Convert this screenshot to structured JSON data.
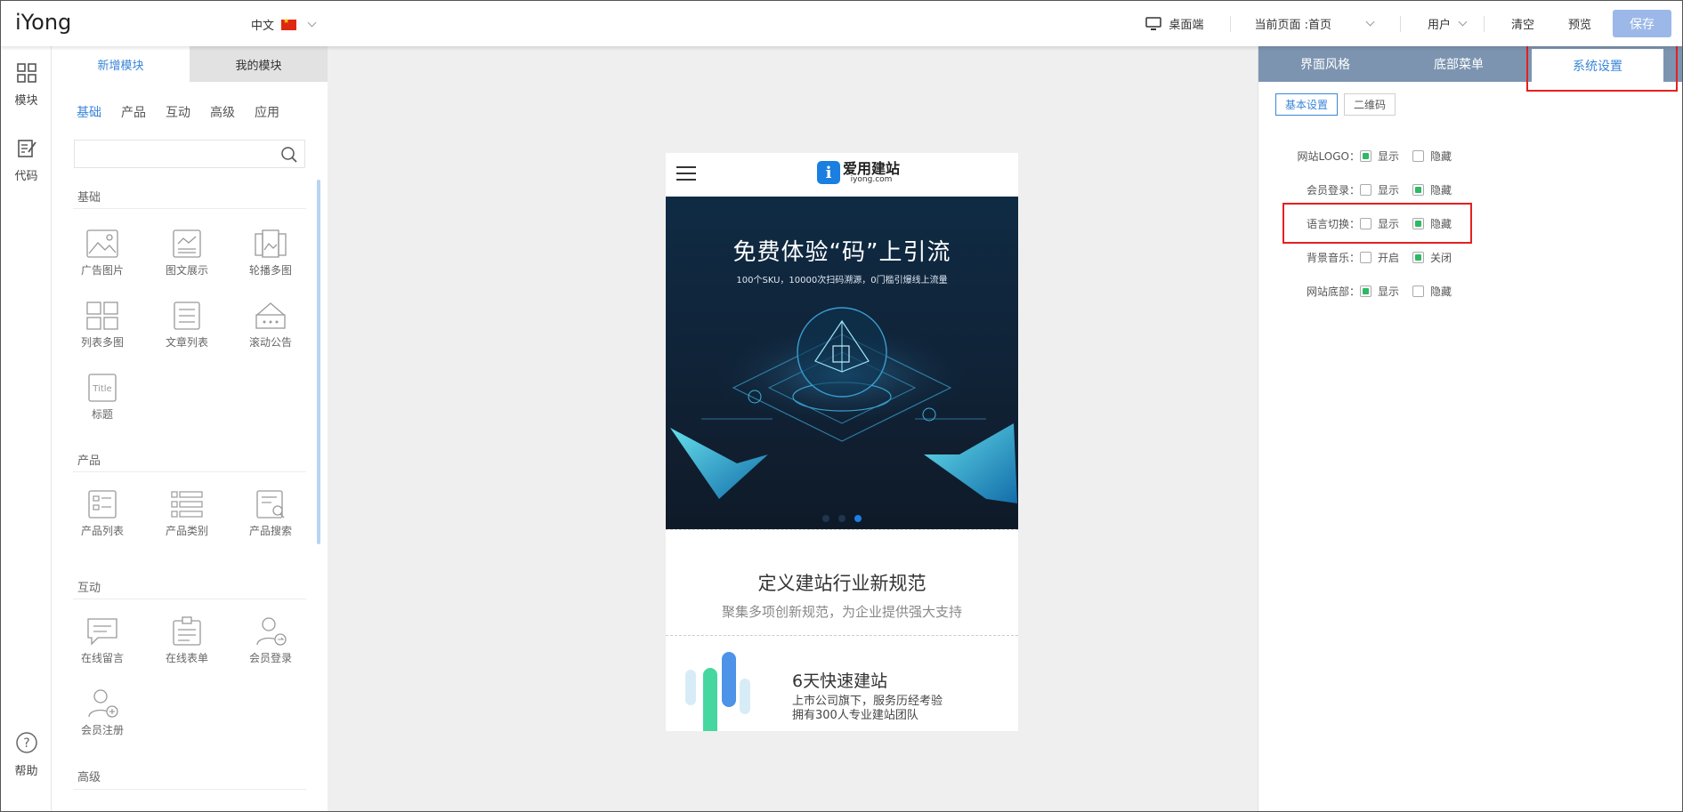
{
  "topbar": {
    "brand": "iYong",
    "language": "中文",
    "device": "桌面端",
    "current_page": "当前页面 :首页",
    "user": "用户",
    "clear": "清空",
    "preview": "预览",
    "save": "保存"
  },
  "rail": {
    "modules": "模块",
    "code": "代码",
    "help": "帮助"
  },
  "modules": {
    "tabs": [
      "新增模块",
      "我的模块"
    ],
    "subtabs": [
      "基础",
      "产品",
      "互动",
      "高级",
      "应用"
    ],
    "sections": {
      "basic": {
        "title": "基础",
        "items": [
          "广告图片",
          "图文展示",
          "轮播多图",
          "列表多图",
          "文章列表",
          "滚动公告",
          "标题"
        ]
      },
      "product": {
        "title": "产品",
        "items": [
          "产品列表",
          "产品类别",
          "产品搜索"
        ]
      },
      "interact": {
        "title": "互动",
        "items": [
          "在线留言",
          "在线表单",
          "会员登录",
          "会员注册"
        ]
      },
      "advanced": {
        "title": "高级"
      }
    }
  },
  "phone": {
    "logo_text": "爱用建站",
    "logo_sub": "iyong.com",
    "banner_title": "免费体验“码”上引流",
    "banner_sub": "100个SKU，10000次扫码溯源，0门槛引爆线上流量",
    "section1_title": "定义建站行业新规范",
    "section1_sub": "聚集多项创新规范，为企业提供强大支持",
    "section2_title": "6天快速建站",
    "section2_line1": "上市公司旗下，服务历经考验",
    "section2_line2": "拥有300人专业建站团队"
  },
  "settings": {
    "tabs": [
      "界面风格",
      "底部菜单",
      "系统设置"
    ],
    "subtabs": [
      "基本设置",
      "二维码"
    ],
    "rows": [
      {
        "label": "网站LOGO：",
        "opt1": "显示",
        "opt2": "隐藏",
        "selected": 1
      },
      {
        "label": "会员登录：",
        "opt1": "显示",
        "opt2": "隐藏",
        "selected": 2
      },
      {
        "label": "语言切换：",
        "opt1": "显示",
        "opt2": "隐藏",
        "selected": 2
      },
      {
        "label": "背景音乐：",
        "opt1": "开启",
        "opt2": "关闭",
        "selected": 2
      },
      {
        "label": "网站底部：",
        "opt1": "显示",
        "opt2": "隐藏",
        "selected": 1
      }
    ]
  },
  "colors": {
    "accent": "#3a86d8",
    "highlight": "#e52020",
    "checked": "#2fb865",
    "save_button": "#9bb8e8",
    "settings_tabbar": "#7c94b0"
  }
}
